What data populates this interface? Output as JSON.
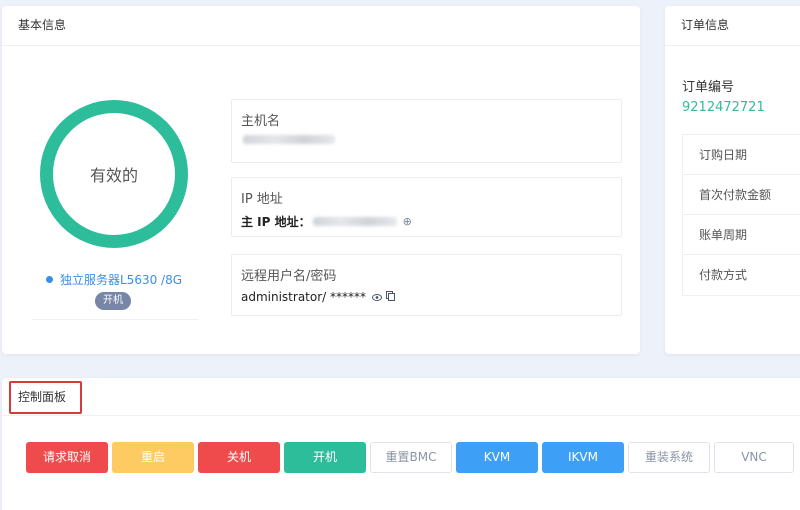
{
  "basic": {
    "title": "基本信息",
    "status_ring": "有效的",
    "product": "独立服务器L5630 /8G",
    "power_state": "开机",
    "hostname": {
      "label": "主机名"
    },
    "ip": {
      "label": "IP 地址",
      "main_ip_label": "主 IP 地址："
    },
    "remote": {
      "label": "远程用户名/密码",
      "value": "administrator/ ******"
    }
  },
  "order": {
    "title": "订单信息",
    "number_label": "订单编号",
    "number": "9212472721",
    "rows": [
      "订购日期",
      "首次付款金额",
      "账单周期",
      "付款方式"
    ]
  },
  "panel": {
    "title": "控制面板",
    "buttons": [
      {
        "label": "请求取消"
      },
      {
        "label": "重启"
      },
      {
        "label": "关机"
      },
      {
        "label": "开机"
      },
      {
        "label": "重置BMC"
      },
      {
        "label": "KVM"
      },
      {
        "label": "IKVM"
      },
      {
        "label": "重装系统"
      },
      {
        "label": "VNC"
      }
    ]
  },
  "colors": {
    "accent_green": "#2ebd9b",
    "link_blue": "#3a8ee6",
    "danger_red": "#ef4b4d",
    "warning_yellow": "#fdcb62",
    "primary_blue": "#3d9ff5"
  }
}
